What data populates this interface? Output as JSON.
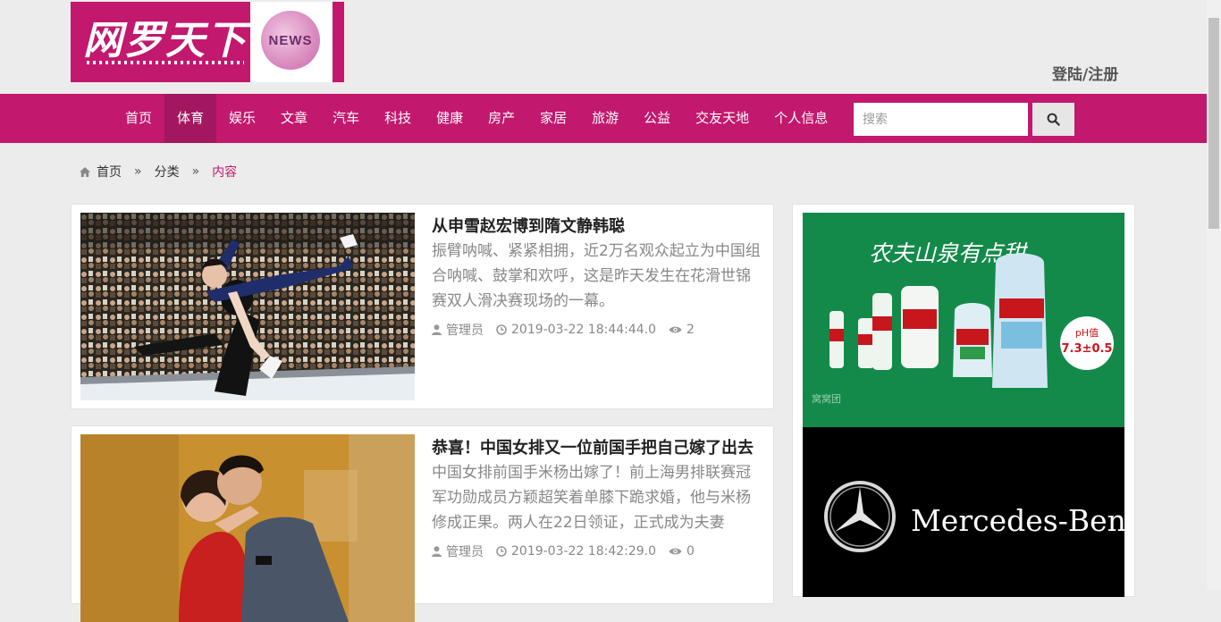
{
  "header": {
    "logo_text": "网罗天下",
    "logo_badge": "NEWS",
    "login_label": "登陆/注册"
  },
  "nav": {
    "items": [
      "首页",
      "体育",
      "娱乐",
      "文章",
      "汽车",
      "科技",
      "健康",
      "房产",
      "家居",
      "旅游",
      "公益",
      "交友天地",
      "个人信息"
    ],
    "active": "体育",
    "search_placeholder": "搜索"
  },
  "breadcrumb": {
    "home": "首页",
    "category": "分类",
    "current": "内容",
    "separator": "»"
  },
  "articles": [
    {
      "title": "从申雪赵宏博到隋文静韩聪",
      "summary": "振臂呐喊、紧紧相拥，近2万名观众起立为中国组合呐喊、鼓掌和欢呼，这是昨天发生在花滑世锦赛双人滑决赛现场的一幕。",
      "author": "管理员",
      "date": "2019-03-22 18:44:44.0",
      "views": "2"
    },
    {
      "title": "恭喜！中国女排又一位前国手把自己嫁了出去",
      "summary": "中国女排前国手米杨出嫁了！前上海男排联赛冠军功勋成员方颖超笑着单膝下跪求婚，他与米杨修成正果。两人在22日领证，正式成为夫妻",
      "author": "管理员",
      "date": "2019-03-22 18:42:29.0",
      "views": "0"
    }
  ],
  "ads": {
    "water_slogan": "农夫山泉有点甜",
    "water_ph_label": "pH值",
    "water_ph_value": "7.3±0.5",
    "water_watermark": "窝窝团",
    "benz_brand": "Mercedes-Benz"
  },
  "colors": {
    "brand": "#c2186e",
    "nav_active": "#a31760",
    "background": "#ececec"
  },
  "icons": {
    "search": "search-icon",
    "home": "home-icon",
    "user": "user-icon",
    "clock": "clock-icon",
    "eye": "eye-icon"
  }
}
